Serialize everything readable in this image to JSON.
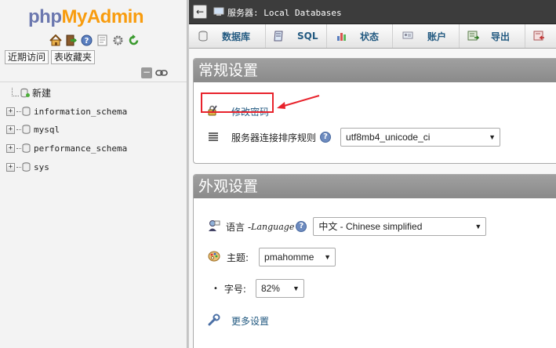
{
  "logo": {
    "part1": "php",
    "part2": "MyAdmin"
  },
  "nav": {
    "icons": [
      "home-icon",
      "exit-icon",
      "help-icon",
      "docs-icon",
      "settings-icon",
      "reload-icon"
    ],
    "recent_tab": "近期访问",
    "favorites_tab": "表收藏夹",
    "collapse_symbol": "−",
    "tree": {
      "new_label": "新建",
      "databases": [
        "information_schema",
        "mysql",
        "performance_schema",
        "sys"
      ]
    }
  },
  "topbar": {
    "back_symbol": "←",
    "breadcrumb": "服务器: Local Databases"
  },
  "menu": {
    "items": [
      {
        "label": "数据库",
        "icon": "database-icon"
      },
      {
        "label": "SQL",
        "icon": "sql-icon"
      },
      {
        "label": "状态",
        "icon": "status-icon"
      },
      {
        "label": "账户",
        "icon": "accounts-icon"
      },
      {
        "label": "导出",
        "icon": "export-icon"
      }
    ]
  },
  "general_settings": {
    "title": "常规设置",
    "change_password": "修改密码",
    "collation_label": "服务器连接排序规则",
    "collation_value": "utf8mb4_unicode_ci"
  },
  "appearance_settings": {
    "title": "外观设置",
    "language_label": "语言 - ",
    "language_italic": "Language",
    "language_value": "中文 - Chinese simplified",
    "theme_label": "主题:",
    "theme_value": "pmahomme",
    "font_size_label": "字号:",
    "font_size_value": "82%",
    "more_settings": "更多设置"
  },
  "help_symbol": "?",
  "colors": {
    "accent": "#235a81",
    "highlight": "#e8232c",
    "logo_php": "#6c78af",
    "logo_admin": "#f89c0e"
  }
}
